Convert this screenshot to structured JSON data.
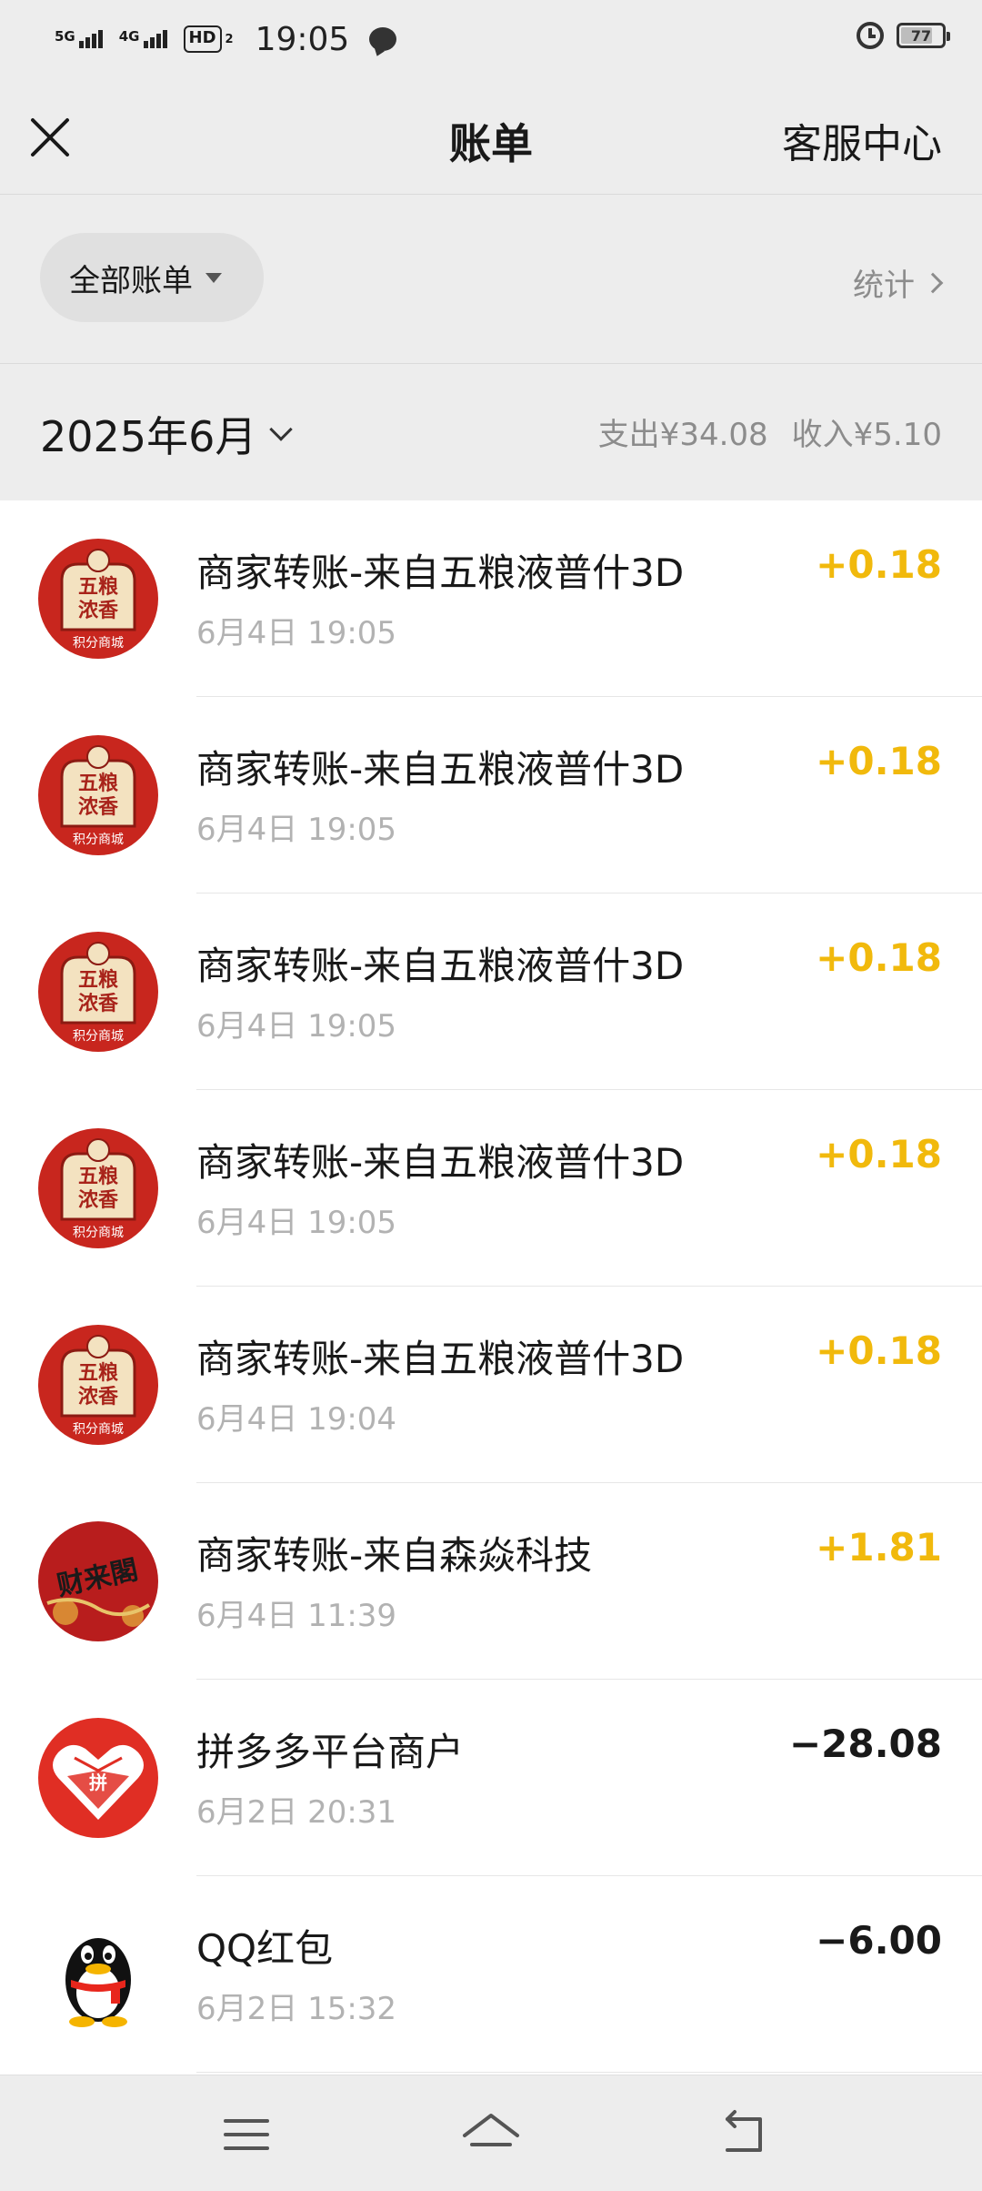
{
  "status_bar": {
    "signal1_label": "5G",
    "signal2_label": "4G",
    "hd_label": "HD",
    "hd_sub": "2",
    "time": "19:05",
    "battery": "77",
    "battery_level": 0.77
  },
  "header": {
    "title": "账单",
    "service_label": "客服中心"
  },
  "filter": {
    "all_bills_label": "全部账单",
    "stats_label": "统计"
  },
  "month": {
    "label": "2025年6月",
    "expense": "支出¥34.08",
    "income": "收入¥5.10"
  },
  "transactions": [
    {
      "title": "商家转账-来自五粮液普什3D",
      "time": "6月4日 19:05",
      "amount": "+0.18",
      "avatar": "wuliangye",
      "avatar_top": "五粮",
      "avatar_mid": "浓香",
      "avatar_caption": "积分商城"
    },
    {
      "title": "商家转账-来自五粮液普什3D",
      "time": "6月4日 19:05",
      "amount": "+0.18",
      "avatar": "wuliangye",
      "avatar_top": "五粮",
      "avatar_mid": "浓香",
      "avatar_caption": "积分商城"
    },
    {
      "title": "商家转账-来自五粮液普什3D",
      "time": "6月4日 19:05",
      "amount": "+0.18",
      "avatar": "wuliangye",
      "avatar_top": "五粮",
      "avatar_mid": "浓香",
      "avatar_caption": "积分商城"
    },
    {
      "title": "商家转账-来自五粮液普什3D",
      "time": "6月4日 19:05",
      "amount": "+0.18",
      "avatar": "wuliangye",
      "avatar_top": "五粮",
      "avatar_mid": "浓香",
      "avatar_caption": "积分商城"
    },
    {
      "title": "商家转账-来自五粮液普什3D",
      "time": "6月4日 19:04",
      "amount": "+0.18",
      "avatar": "wuliangye",
      "avatar_top": "五粮",
      "avatar_mid": "浓香",
      "avatar_caption": "积分商城"
    },
    {
      "title": "商家转账-来自森焱科技",
      "time": "6月4日 11:39",
      "amount": "+1.81",
      "avatar": "caiyuange",
      "avatar_text": "财来閣"
    },
    {
      "title": "拼多多平台商户",
      "time": "6月2日 20:31",
      "amount": "−28.08",
      "avatar": "pinduoduo",
      "avatar_text": "拼"
    },
    {
      "title": "QQ红包",
      "time": "6月2日 15:32",
      "amount": "−6.00",
      "avatar": "qq-penguin"
    }
  ],
  "colors": {
    "income": "#f1b90c",
    "expense": "#191919",
    "background": "#ededed",
    "wuliangye_red": "#c8261e",
    "pdd_red": "#e02e24"
  },
  "icons": [
    "close-icon",
    "caret-down-icon",
    "chevron-right-icon",
    "chevron-down-icon",
    "alarm-icon",
    "battery-icon",
    "message-icon",
    "menu-icon",
    "home-icon",
    "back-icon"
  ]
}
